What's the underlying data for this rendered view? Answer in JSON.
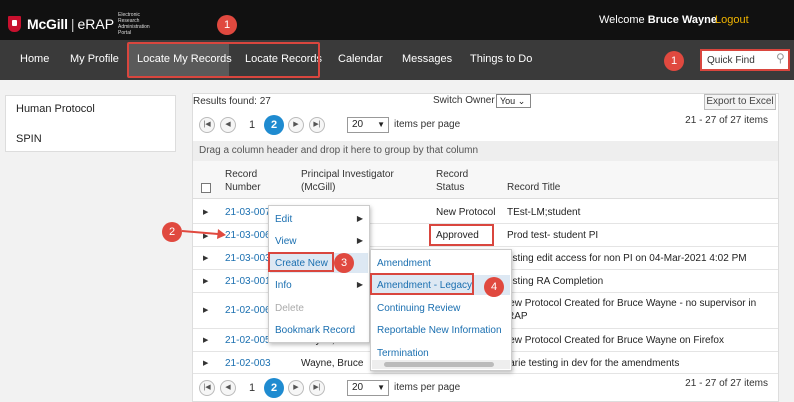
{
  "header": {
    "brand": "McGill",
    "app": "eRAP",
    "app_sub": "Electronic Research Administration Portal",
    "welcome_prefix": "Welcome",
    "user_name": "Bruce Wayne",
    "logout": "Logout"
  },
  "nav": {
    "items": [
      "Home",
      "My Profile",
      "Locate My Records",
      "Locate Records",
      "Calendar",
      "Messages",
      "Things to Do"
    ],
    "active": "Locate My Records",
    "quick_find_placeholder": "Quick Find"
  },
  "sidebar": {
    "items": [
      "Human Protocol",
      "SPIN"
    ]
  },
  "toolbar": {
    "results": "Results found: 27",
    "switch_owner_label": "Switch Owner",
    "owner_value": "You",
    "export": "Export to Excel"
  },
  "pager": {
    "first": "|◀",
    "prev": "◀",
    "next": "▶",
    "last": "▶|",
    "pages": [
      "1",
      "2"
    ],
    "current_page": "2",
    "page_size": "20",
    "items_per_page": "items per page",
    "range": "21 - 27 of 27 items"
  },
  "group_hint": "Drag a column header and drop it here to group by that column",
  "grid": {
    "headers": [
      "Record Number",
      "Principal Investigator (McGill)",
      "Record Status",
      "Record Title"
    ],
    "rows": [
      {
        "number": "21-03-007",
        "pi": "",
        "status": "New Protocol",
        "title": "TEst-LM;student"
      },
      {
        "number": "21-03-006",
        "pi": "",
        "status": "Approved",
        "title": "Prod test- student PI"
      },
      {
        "number": "21-03-003",
        "pi": "",
        "status": "",
        "title": "esting edit access for non PI on 04-Mar-2021 4:02 PM"
      },
      {
        "number": "21-03-001",
        "pi": "",
        "status": "",
        "title": "esting RA Completion"
      },
      {
        "number": "21-02-006",
        "pi": "",
        "status": "",
        "title": "lew Protocol Created for Bruce Wayne - no supervisor in RAP"
      },
      {
        "number": "21-02-005",
        "pi": "Wayne, Bruce",
        "status": "",
        "title": "lew Protocol Created for Bruce Wayne on Firefox"
      },
      {
        "number": "21-02-003",
        "pi": "Wayne, Bruce",
        "status": "",
        "title": "larie testing in dev for the amendments"
      }
    ]
  },
  "context_menu": {
    "items": [
      "Edit",
      "View",
      "Create New",
      "Info",
      "Delete",
      "Bookmark Record"
    ]
  },
  "submenu": {
    "items": [
      "Amendment",
      "Amendment - Legacy",
      "Continuing Review",
      "Reportable New Information",
      "Termination"
    ]
  },
  "callouts": [
    "1",
    "1",
    "2",
    "3",
    "4"
  ],
  "colors": {
    "accent": "#1f8bd0",
    "callout": "#e0493f",
    "logout": "#f0b400"
  }
}
